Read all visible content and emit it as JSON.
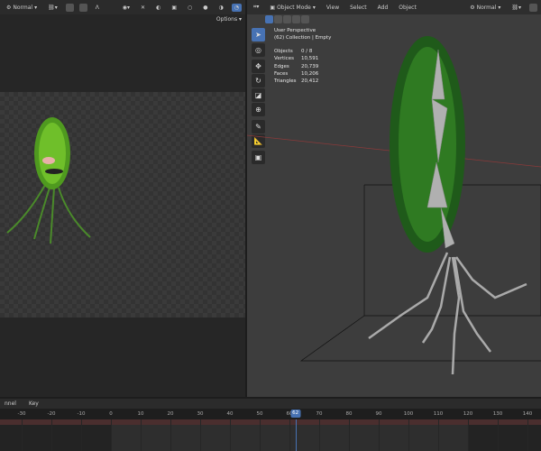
{
  "left_editor": {
    "shading_mode": "Normal",
    "options_label": "Options"
  },
  "right_editor": {
    "mode": "Object Mode",
    "menus": [
      "View",
      "Select",
      "Add",
      "Object"
    ],
    "shading_mode": "Normal",
    "overlay": {
      "view_name": "User Perspective",
      "collection": "(62) Collection | Empty",
      "stats": [
        {
          "k": "Objects",
          "v": "0 / 8"
        },
        {
          "k": "Vertices",
          "v": "10,591"
        },
        {
          "k": "Edges",
          "v": "20,739"
        },
        {
          "k": "Faces",
          "v": "10,206"
        },
        {
          "k": "Triangles",
          "v": "20,412"
        }
      ]
    },
    "tools": [
      "select-box-icon",
      "cursor-icon",
      "move-icon",
      "rotate-icon",
      "scale-icon",
      "transform-icon",
      "annotate-icon",
      "measure-icon",
      "add-cube-icon"
    ]
  },
  "timeline": {
    "menus": [
      "nnel",
      "Key"
    ],
    "ticks": [
      "-30",
      "-20",
      "-10",
      "0",
      "10",
      "20",
      "30",
      "40",
      "50",
      "60",
      "62",
      "70",
      "80",
      "90",
      "100",
      "110",
      "120",
      "130",
      "140"
    ],
    "current_frame": "62",
    "frame_start": 0,
    "frame_end": 120,
    "accent": "#4772b3"
  }
}
